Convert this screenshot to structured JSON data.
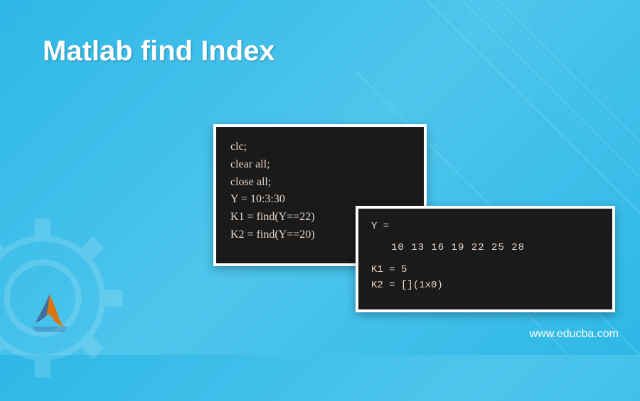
{
  "title": "Matlab find Index",
  "code1": {
    "line1": "clc;",
    "line2": "clear all;",
    "line3": "close all;",
    "line4": "Y = 10:3:30",
    "line5": "K1 = find(Y==22)",
    "line6": "K2 = find(Y==20)"
  },
  "code2": {
    "line1": "Y =",
    "values": "10   13   16   19   22   25   28",
    "line3": "K1 = 5",
    "line4": "K2 = [](1x0)"
  },
  "website": "www.educba.com"
}
